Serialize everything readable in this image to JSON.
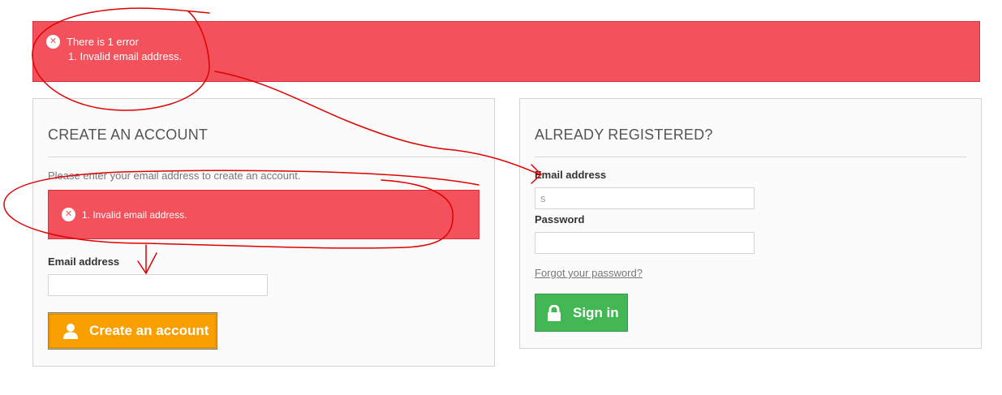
{
  "top_alert": {
    "title": "There is 1 error",
    "item": "1. Invalid email address."
  },
  "create_account": {
    "heading": "CREATE AN ACCOUNT",
    "hint": "Please enter your email address to create an account.",
    "error_item": "1. Invalid email address.",
    "email_label": "Email address",
    "email_value": "",
    "button_label": "Create an account"
  },
  "login": {
    "heading": "ALREADY REGISTERED?",
    "email_label": "Email address",
    "email_value": "s",
    "password_label": "Password",
    "password_value": "",
    "forgot_link": "Forgot your password?",
    "button_label": "Sign in"
  },
  "colors": {
    "error_red": "#f3515c",
    "create_orange": "#f9a000",
    "signin_green": "#43b754",
    "annotation_red": "#e00000"
  },
  "icons": [
    "close-circle-icon",
    "user-icon",
    "lock-icon"
  ]
}
